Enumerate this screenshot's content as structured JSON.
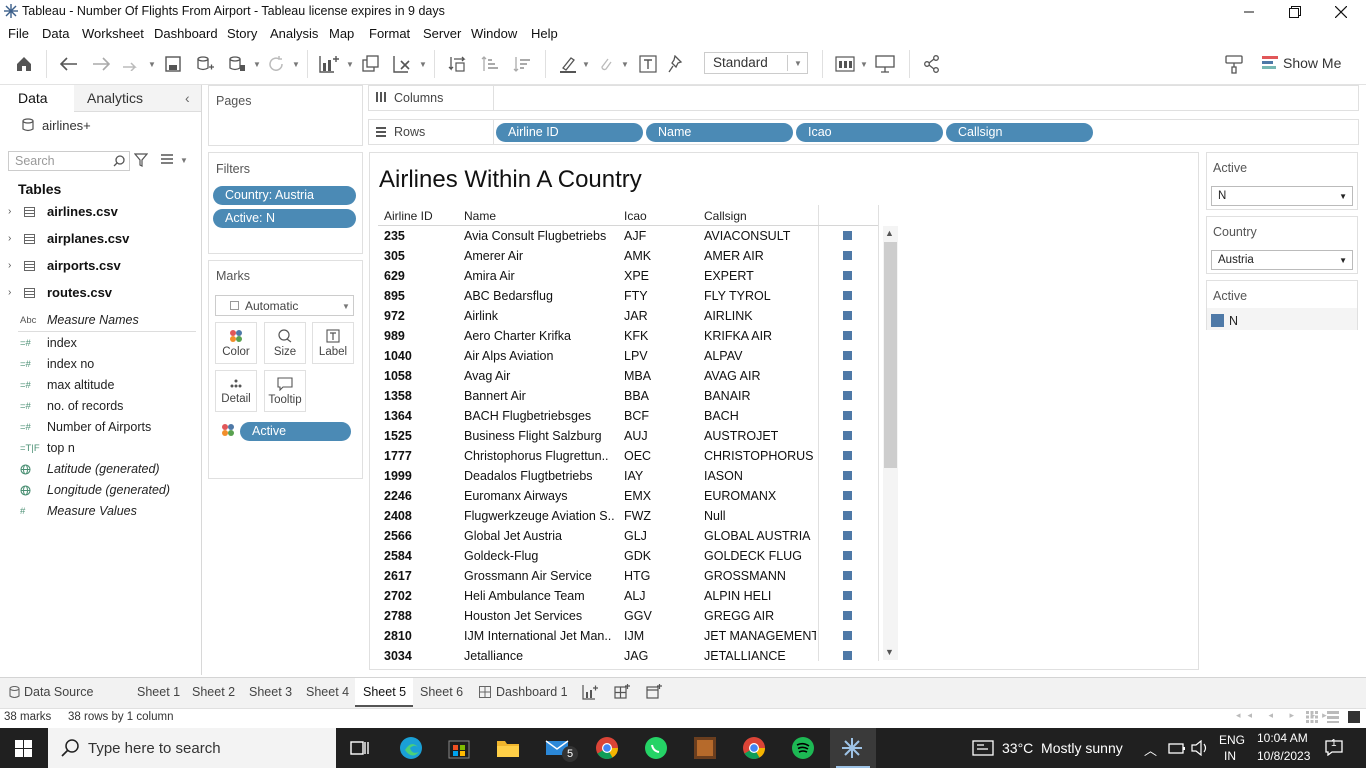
{
  "window": {
    "title": "Tableau - Number Of Flights From Airport - Tableau license expires in 9 days"
  },
  "menu": [
    "File",
    "Data",
    "Worksheet",
    "Dashboard",
    "Story",
    "Analysis",
    "Map",
    "Format",
    "Server",
    "Window",
    "Help"
  ],
  "toolbar": {
    "fit_select": "Standard",
    "show_me": "Show Me"
  },
  "datapane": {
    "tab_data": "Data",
    "tab_analytics": "Analytics",
    "datasource": "airlines+",
    "search_placeholder": "Search",
    "tables_heading": "Tables",
    "tables": [
      "airlines.csv",
      "airplanes.csv",
      "airports.csv",
      "routes.csv"
    ],
    "fields": [
      {
        "icon": "Abc",
        "label": "Measure Names"
      },
      {
        "icon": "=#",
        "label": "index"
      },
      {
        "icon": "=#",
        "label": "index no"
      },
      {
        "icon": "=#",
        "label": "max altitude"
      },
      {
        "icon": "=#",
        "label": "no. of records"
      },
      {
        "icon": "=#",
        "label": "Number of Airports"
      },
      {
        "icon": "=T|F",
        "label": "top n"
      },
      {
        "icon": "globe",
        "label": "Latitude (generated)"
      },
      {
        "icon": "globe",
        "label": "Longitude (generated)"
      },
      {
        "icon": "#",
        "label": "Measure Values"
      }
    ]
  },
  "pages": {
    "title": "Pages"
  },
  "filters": {
    "title": "Filters",
    "items": [
      "Country: Austria",
      "Active: N"
    ]
  },
  "marks": {
    "title": "Marks",
    "type": "Automatic",
    "buttons": [
      "Color",
      "Size",
      "Label",
      "Detail",
      "Tooltip"
    ],
    "pill": "Active"
  },
  "shelves": {
    "columns_label": "Columns",
    "rows_label": "Rows",
    "rows_pills": [
      "Airline ID",
      "Name",
      "Icao",
      "Callsign"
    ]
  },
  "viz": {
    "title": "Airlines Within A Country",
    "headers": [
      "Airline ID",
      "Name",
      "Icao",
      "Callsign"
    ],
    "rows": [
      [
        "235",
        "Avia Consult Flugbetriebs",
        "AJF",
        "AVIACONSULT"
      ],
      [
        "305",
        "Amerer Air",
        "AMK",
        "AMER AIR"
      ],
      [
        "629",
        "Amira Air",
        "XPE",
        "EXPERT"
      ],
      [
        "895",
        "ABC Bedarsflug",
        "FTY",
        "FLY TYROL"
      ],
      [
        "972",
        "Airlink",
        "JAR",
        "AIRLINK"
      ],
      [
        "989",
        "Aero Charter Krifka",
        "KFK",
        "KRIFKA AIR"
      ],
      [
        "1040",
        "Air Alps Aviation",
        "LPV",
        "ALPAV"
      ],
      [
        "1058",
        "Avag Air",
        "MBA",
        "AVAG AIR"
      ],
      [
        "1358",
        "Bannert Air",
        "BBA",
        "BANAIR"
      ],
      [
        "1364",
        "BACH Flugbetriebsges",
        "BCF",
        "BACH"
      ],
      [
        "1525",
        "Business Flight Salzburg",
        "AUJ",
        "AUSTROJET"
      ],
      [
        "1777",
        "Christophorus Flugrettun..",
        "OEC",
        "CHRISTOPHORUS"
      ],
      [
        "1999",
        "Deadalos Flugtbetriebs",
        "IAY",
        "IASON"
      ],
      [
        "2246",
        "Euromanx Airways",
        "EMX",
        "EUROMANX"
      ],
      [
        "2408",
        "Flugwerkzeuge Aviation S..",
        "FWZ",
        "Null"
      ],
      [
        "2566",
        "Global Jet Austria",
        "GLJ",
        "GLOBAL AUSTRIA"
      ],
      [
        "2584",
        "Goldeck-Flug",
        "GDK",
        "GOLDECK FLUG"
      ],
      [
        "2617",
        "Grossmann Air Service",
        "HTG",
        "GROSSMANN"
      ],
      [
        "2702",
        "Heli Ambulance Team",
        "ALJ",
        "ALPIN HELI"
      ],
      [
        "2788",
        "Houston Jet Services",
        "GGV",
        "GREGG AIR"
      ],
      [
        "2810",
        "IJM International Jet Man..",
        "IJM",
        "JET MANAGEMENT"
      ],
      [
        "3034",
        "Jetalliance",
        "JAG",
        "JETALLIANCE"
      ]
    ],
    "mark_color": "#4e79a7"
  },
  "right": {
    "filter1_title": "Active",
    "filter1_value": "N",
    "filter2_title": "Country",
    "filter2_value": "Austria",
    "legend_title": "Active",
    "legend_value": "N"
  },
  "sheets": {
    "datasource": "Data Source",
    "tabs": [
      "Sheet 1",
      "Sheet 2",
      "Sheet 3",
      "Sheet 4",
      "Sheet 5",
      "Sheet 6"
    ],
    "active": "Sheet 5",
    "dashboard": "Dashboard 1"
  },
  "status": {
    "marks": "38 marks",
    "rows": "38 rows by 1 column"
  },
  "taskbar": {
    "search_placeholder": "Type here to search",
    "weather": "33°C  Mostly sunny",
    "lang1": "ENG",
    "lang2": "IN",
    "time": "10:04 AM",
    "date": "10/8/2023",
    "mail_badge": "5",
    "notif_badge": "1"
  }
}
